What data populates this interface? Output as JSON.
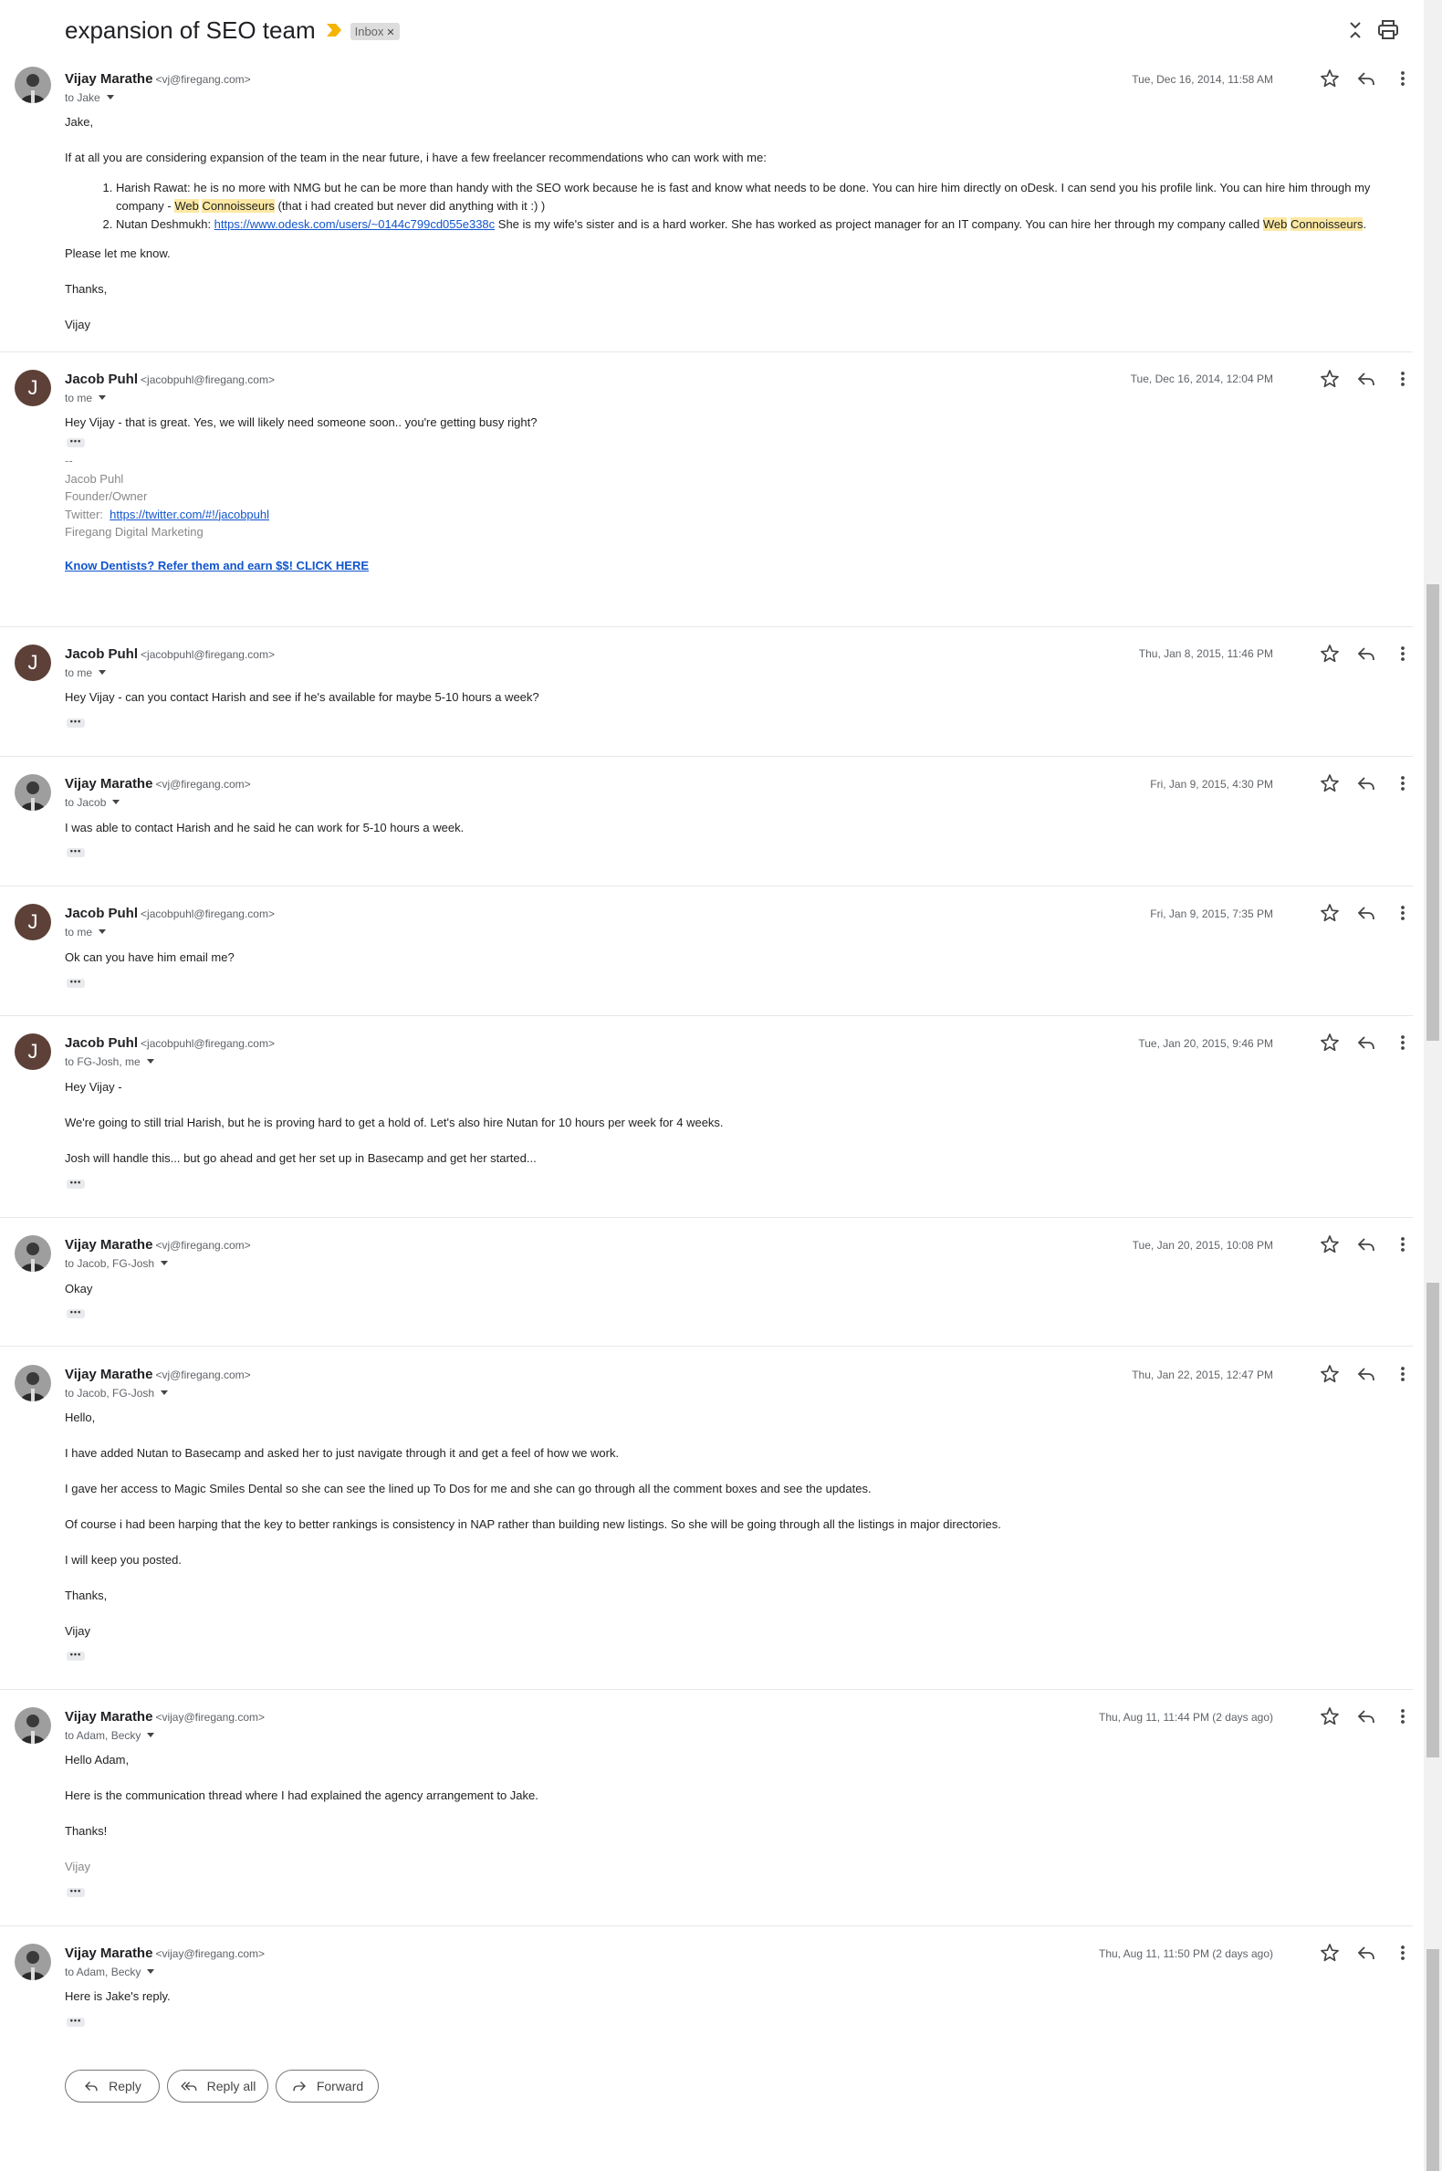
{
  "header": {
    "subject": "expansion of SEO team",
    "label": "Inbox",
    "collapse_icon": "collapse-all-icon",
    "print_icon": "print-icon",
    "importance_color": "#f4b400"
  },
  "messages": [
    {
      "sender": "Vijay Marathe",
      "email": "<vj@firegang.com>",
      "to": "to Jake",
      "date": "Tue, Dec 16, 2014, 11:58 AM",
      "greeting": "Jake,",
      "intro": "If at all you are considering expansion of the team in the near future, i have a few freelancer recommendations who can work with me:",
      "item1_a": "Harish Rawat: he is no more with NMG but he can be more than handy with the SEO work because he is fast and know what needs to be done. You can hire him directly on oDesk. I can send you his profile link. You can hire him through my company - ",
      "item1_hl1": "Web",
      "item1_hl2": "Connoisseurs",
      "item1_b": " (that i had created but never did anything with it :) )",
      "item2_a": "Nutan Deshmukh: ",
      "item2_link": "https://www.odesk.com/users/~0144c799cd055e338c",
      "item2_b": " She is my wife's sister and is a hard worker. She has worked as project manager for an IT company. You can hire her through my company called ",
      "item2_hl1": "Web",
      "item2_hl2": "Connoisseurs",
      "item2_c": ".",
      "closing1": "Please let me know.",
      "closing2": "Thanks,",
      "closing3": "Vijay"
    },
    {
      "sender": "Jacob Puhl",
      "email": "<jacobpuhl@firegang.com>",
      "to": "to me",
      "date": "Tue, Dec 16, 2014, 12:04 PM",
      "avatar_letter": "J",
      "line1": "Hey Vijay - that is great. Yes, we will likely need someone soon.. you're getting busy right?",
      "sig_dash": "--",
      "sig_name": "Jacob Puhl",
      "sig_title": "Founder/Owner",
      "sig_twitter_label": "Twitter:",
      "sig_twitter_link": "https://twitter.com/#!/jacobpuhl",
      "sig_company": "Firegang Digital Marketing",
      "promo_link": "Know Dentists?  Refer them and earn $$!  CLICK HERE"
    },
    {
      "sender": "Jacob Puhl",
      "email": "<jacobpuhl@firegang.com>",
      "to": "to me",
      "date": "Thu, Jan 8, 2015, 11:46 PM",
      "avatar_letter": "J",
      "line1": "Hey Vijay - can you contact Harish and see if he's available for maybe 5-10 hours a week?"
    },
    {
      "sender": "Vijay Marathe",
      "email": "<vj@firegang.com>",
      "to": "to Jacob",
      "date": "Fri, Jan 9, 2015, 4:30 PM",
      "line1": "I was able to contact Harish and he said he can work for 5-10 hours a week."
    },
    {
      "sender": "Jacob Puhl",
      "email": "<jacobpuhl@firegang.com>",
      "to": "to me",
      "date": "Fri, Jan 9, 2015, 7:35 PM",
      "avatar_letter": "J",
      "line1": "Ok can you have him email me?"
    },
    {
      "sender": "Jacob Puhl",
      "email": "<jacobpuhl@firegang.com>",
      "to": "to FG-Josh, me",
      "date": "Tue, Jan 20, 2015, 9:46 PM",
      "avatar_letter": "J",
      "line1": "Hey Vijay -",
      "line2": "We're going to still trial Harish, but he is proving hard to get a hold of. Let's also hire Nutan for 10 hours per week for 4 weeks.",
      "line3": "Josh will handle this... but go ahead and get her set up in Basecamp and get her started..."
    },
    {
      "sender": "Vijay Marathe",
      "email": "<vj@firegang.com>",
      "to": "to Jacob, FG-Josh",
      "date": "Tue, Jan 20, 2015, 10:08 PM",
      "line1": "Okay"
    },
    {
      "sender": "Vijay Marathe",
      "email": "<vj@firegang.com>",
      "to": "to Jacob, FG-Josh",
      "date": "Thu, Jan 22, 2015, 12:47 PM",
      "line1": "Hello,",
      "line2": "I have added Nutan to Basecamp and asked her to just navigate through it and get a feel of how we work.",
      "line3": "I gave her access to Magic Smiles Dental so she can see the lined up To Dos for me and she can go through all the comment boxes and see the updates.",
      "line4": "Of course i had been harping that the key to better rankings is consistency in NAP rather than building new listings. So she will be going through all the listings in major directories.",
      "line5": "I will keep you posted.",
      "line6": "Thanks,",
      "line7": "Vijay"
    },
    {
      "sender": "Vijay Marathe",
      "email": "<vijay@firegang.com>",
      "to": "to Adam, Becky",
      "date": "Thu, Aug 11, 11:44 PM (2 days ago)",
      "line1": "Hello Adam,",
      "line2": "Here is the communication thread where I had explained the agency arrangement to Jake.",
      "line3": "Thanks!",
      "line4": "Vijay"
    },
    {
      "sender": "Vijay Marathe",
      "email": "<vijay@firegang.com>",
      "to": "to Adam, Becky",
      "date": "Thu, Aug 11, 11:50 PM (2 days ago)",
      "line1": "Here is Jake's reply."
    }
  ],
  "actions": {
    "reply": "Reply",
    "reply_all": "Reply all",
    "forward": "Forward"
  },
  "icons": {
    "star": "star-icon",
    "reply": "reply-icon",
    "more": "more-vert-icon",
    "ellipsis": "show-trimmed-content-icon"
  }
}
